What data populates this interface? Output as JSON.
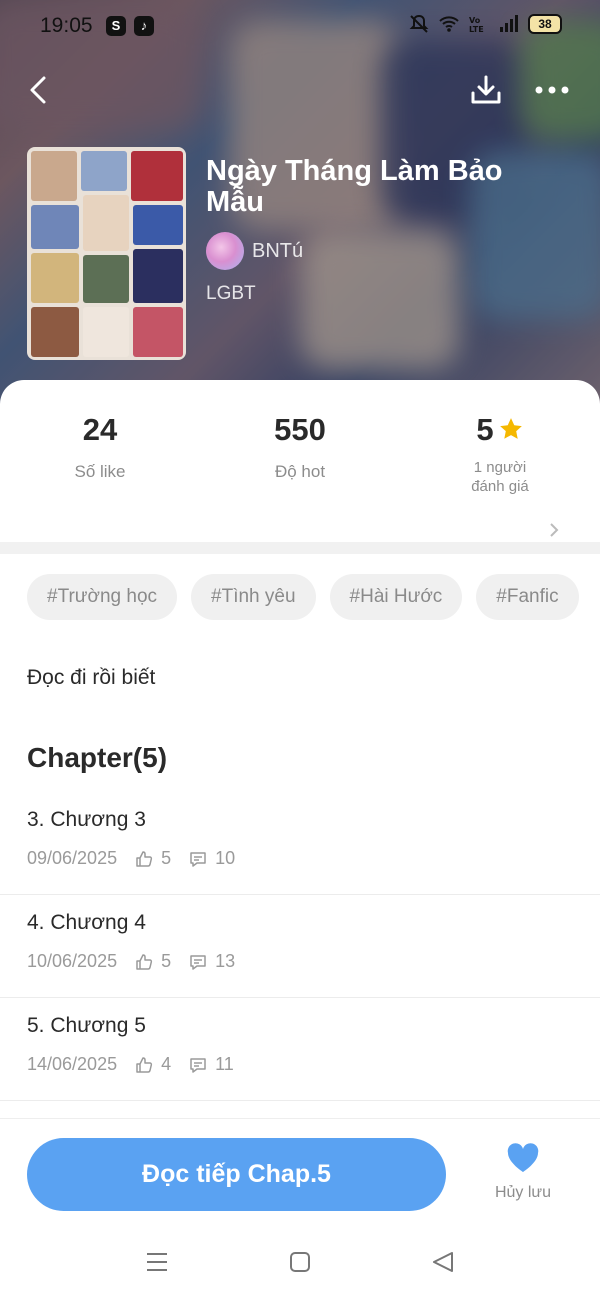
{
  "status_bar": {
    "time": "19:05",
    "battery": "38"
  },
  "book": {
    "title": "Ngày Tháng Làm Bảo Mẫu",
    "author": "BNTú",
    "genre": "LGBT"
  },
  "stats": [
    {
      "value": "24",
      "label": "Số like"
    },
    {
      "value": "550",
      "label": "Độ hot"
    },
    {
      "value": "5",
      "label": "1 người đánh giá"
    }
  ],
  "tags": [
    "#Trường học",
    "#Tình yêu",
    "#Hài Hước",
    "#Fanfic"
  ],
  "description": "Đọc đi rồi biết",
  "chapter_heading": "Chapter(5)",
  "chapters": [
    {
      "title": "3. Chương 3",
      "date": "09/06/2025",
      "likes": "5",
      "comments": "10"
    },
    {
      "title": "4. Chương 4",
      "date": "10/06/2025",
      "likes": "5",
      "comments": "13"
    },
    {
      "title": "5. Chương 5",
      "date": "14/06/2025",
      "likes": "4",
      "comments": "11"
    }
  ],
  "actions": {
    "read_label": "Đọc tiếp Chap.5",
    "unsave_label": "Hủy lưu"
  },
  "colors": {
    "accent": "#5aa2f2",
    "star": "#f5b800"
  },
  "icons": [
    "back-icon",
    "download-icon",
    "more-icon",
    "star-icon",
    "chevron-right-icon",
    "thumbs-up-icon",
    "comment-icon",
    "heart-icon",
    "menu-icon",
    "home-icon",
    "back-triangle-icon"
  ]
}
